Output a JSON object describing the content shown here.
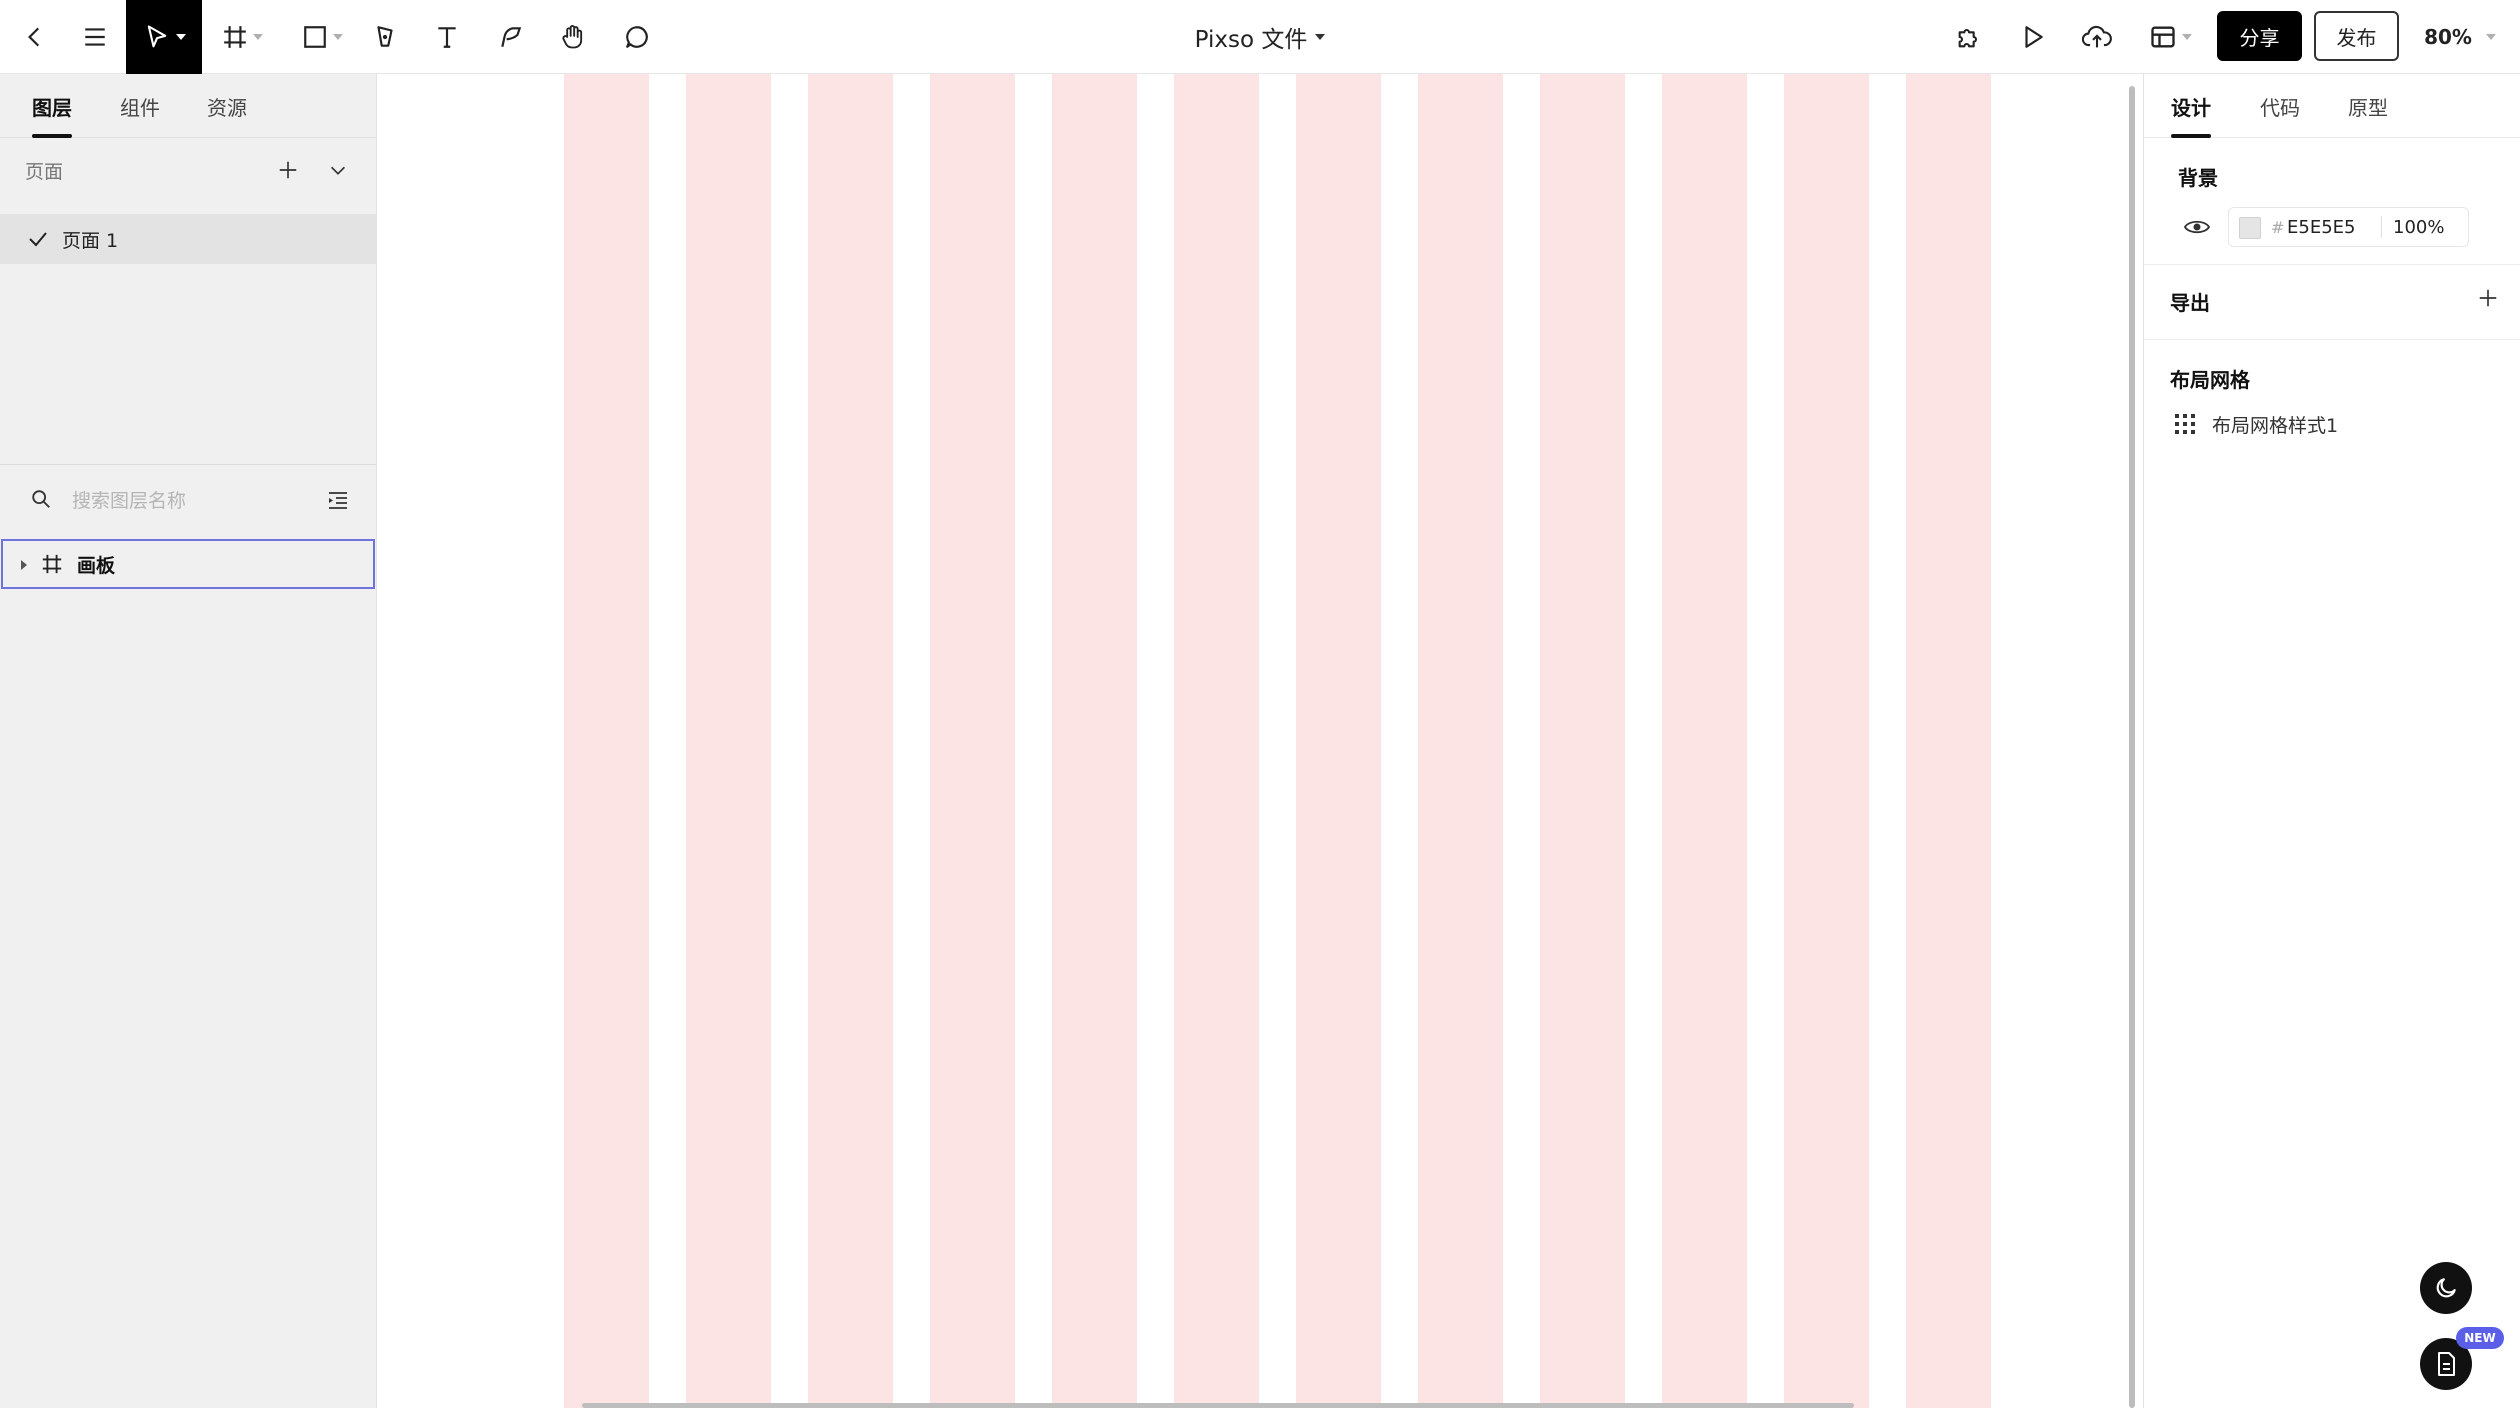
{
  "app": {
    "title": "Pixso 文件",
    "zoom": "80%"
  },
  "toolbar": {
    "icons": [
      "back-icon",
      "menu-icon",
      "move-tool-icon",
      "frame-tool-icon",
      "rectangle-tool-icon",
      "pen-tool-icon",
      "text-tool-icon",
      "pencil-tool-icon",
      "hand-tool-icon",
      "comment-tool-icon",
      "plugin-icon",
      "play-icon",
      "upload-icon",
      "layout-icon"
    ],
    "share_label": "分享",
    "publish_label": "发布"
  },
  "left_panel": {
    "tabs": [
      {
        "label": "图层",
        "active": true
      },
      {
        "label": "组件",
        "active": false
      },
      {
        "label": "资源",
        "active": false
      }
    ],
    "pages_label": "页面",
    "pages": [
      {
        "label": "页面 1",
        "selected": true
      }
    ],
    "search": {
      "placeholder": "搜索图层名称",
      "value": ""
    },
    "layers": [
      {
        "label": "画板",
        "type": "frame",
        "selected": true
      }
    ]
  },
  "canvas": {
    "background": "#ffffff",
    "grid_column_color": "#fde4e4",
    "grid_columns": 12
  },
  "right_panel": {
    "tabs": [
      {
        "label": "设计",
        "active": true
      },
      {
        "label": "代码",
        "active": false
      },
      {
        "label": "原型",
        "active": false
      }
    ],
    "background": {
      "title": "背景",
      "hash": "#",
      "hex": "E5E5E5",
      "opacity": "100%",
      "swatch_color": "#E5E5E5"
    },
    "export": {
      "title": "导出"
    },
    "layout_grid": {
      "title": "布局网格",
      "item_label": "布局网格样式1"
    }
  },
  "floating": {
    "theme_icon": "moon-icon",
    "notes_icon": "document-icon",
    "new_badge": "NEW"
  },
  "colors": {
    "accent_selection": "#6e74d8",
    "badge": "#5b5fe8",
    "primary_button": "#000000"
  }
}
